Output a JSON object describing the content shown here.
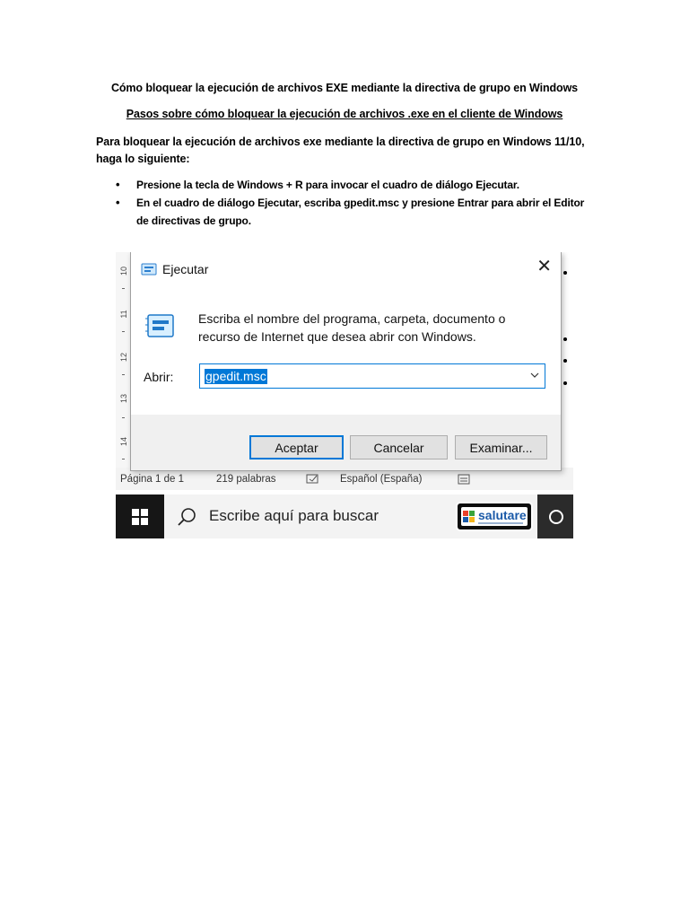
{
  "document": {
    "title": "Cómo bloquear la ejecución de archivos EXE mediante la directiva de grupo en Windows",
    "subtitle": "Pasos sobre cómo bloquear la ejecución de archivos .exe en el cliente de Windows",
    "intro": "Para bloquear la ejecución de archivos exe mediante la directiva de grupo en Windows 11/10, haga lo siguiente:",
    "steps": [
      "Presione la tecla de Windows + R para invocar el cuadro de diálogo Ejecutar.",
      "En el cuadro de diálogo Ejecutar, escriba gpedit.msc y presione Entrar para abrir el Editor de directivas de grupo."
    ],
    "bullet_symbol": "•"
  },
  "screenshot": {
    "ruler_numbers": [
      "10",
      "11",
      "12",
      "13",
      "14"
    ],
    "run_dialog": {
      "title": "Ejecutar",
      "close_glyph": "✕",
      "description": "Escriba el nombre del programa, carpeta, documento o recurso de Internet que desea abrir con Windows.",
      "open_label": "Abrir:",
      "open_value": "gpedit.msc",
      "ok_label": "Aceptar",
      "cancel_label": "Cancelar",
      "browse_label": "Examinar..."
    },
    "status_bar": {
      "page": "Página 1 de 1",
      "words": "219 palabras",
      "language": "Español (España)"
    },
    "taskbar": {
      "search_placeholder": "Escribe aquí para buscar",
      "brand_name": "salutare"
    }
  },
  "colors": {
    "accent": "#0078d7",
    "taskbar": "#1f1f1f",
    "brand_blue": "#1b5aa8"
  }
}
